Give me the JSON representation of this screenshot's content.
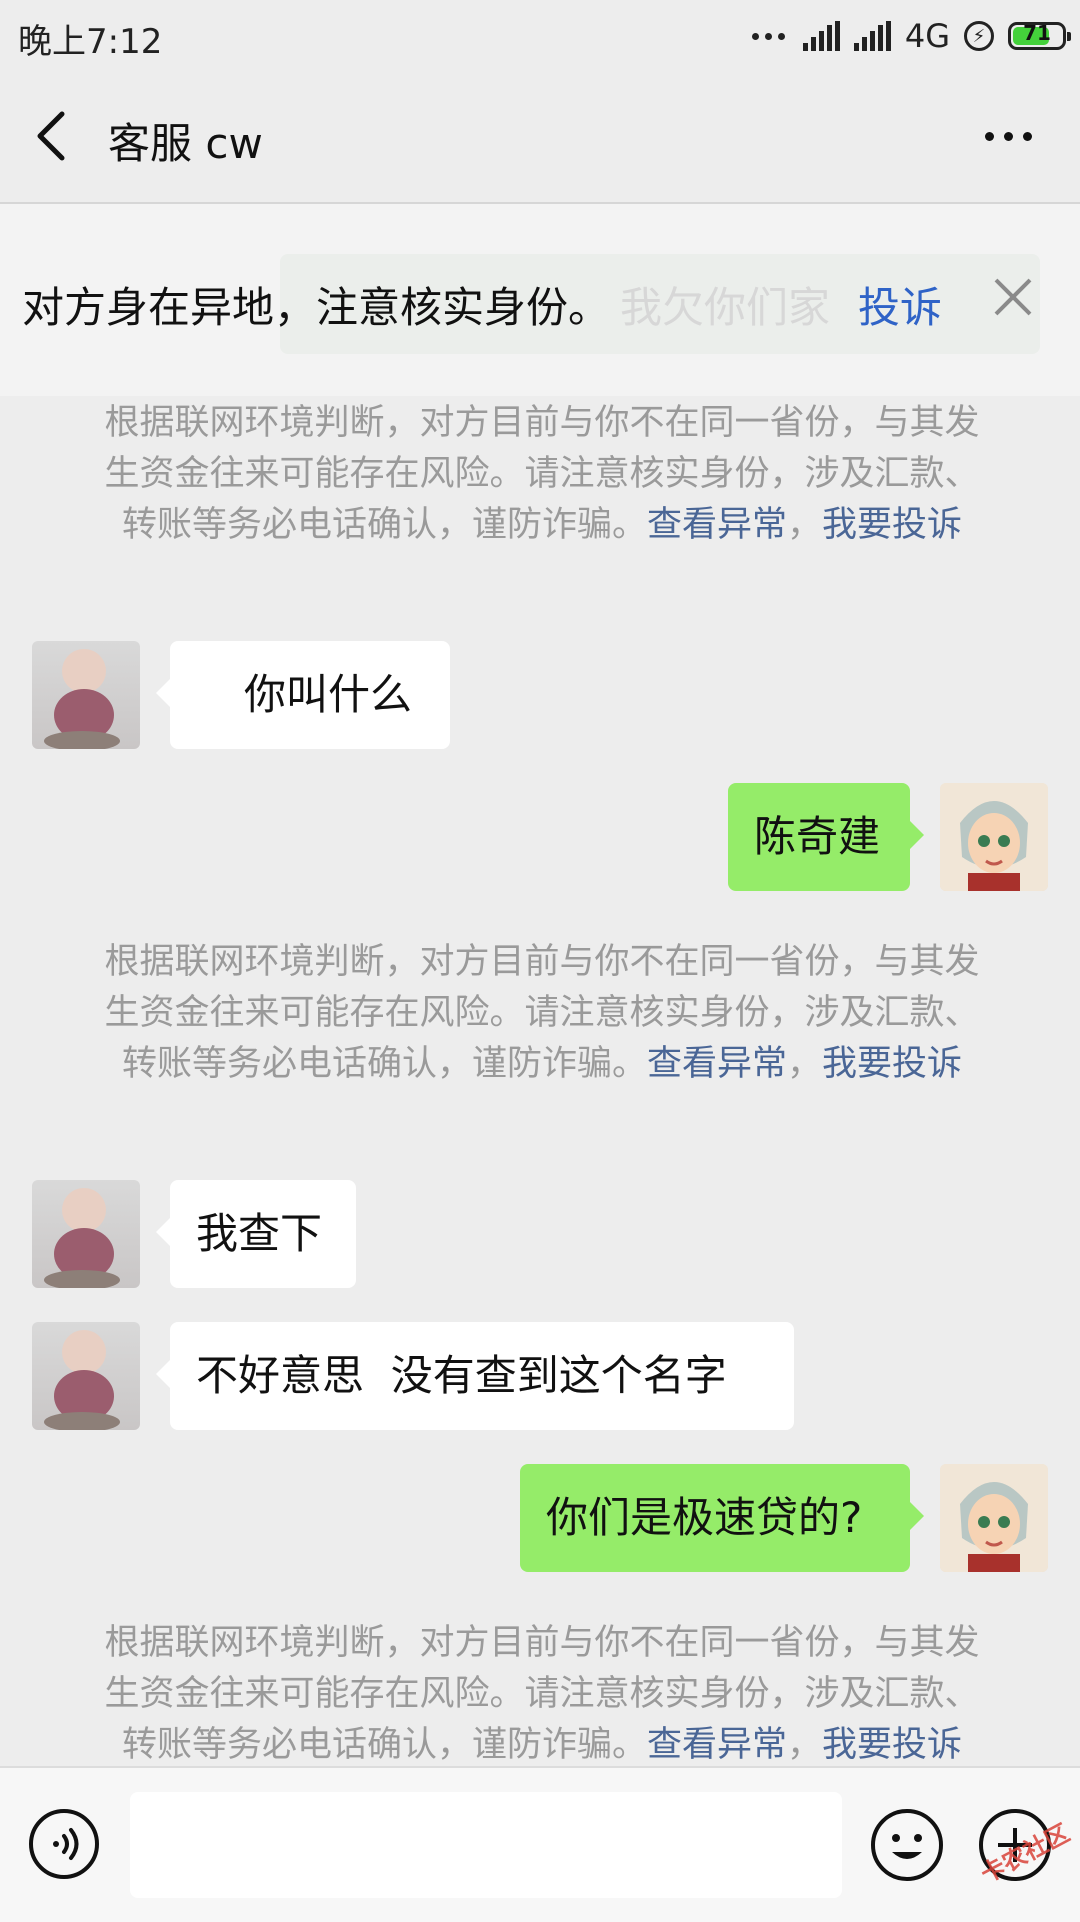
{
  "status_bar": {
    "time": "晚上7:12",
    "network": "4G",
    "battery_level": "71"
  },
  "header": {
    "title": "客服 cw"
  },
  "banner": {
    "text": "对方身在异地，注意核实身份。",
    "link": "投诉",
    "ghost_text": "我欠你们家"
  },
  "notice": {
    "text": "根据联网环境判断，对方目前与你不在同一省份，与其发生资金往来可能存在风险。请注意核实身份，涉及汇款、转账等务必电话确认，谨防诈骗。",
    "link_view": "查看异常",
    "separator": "，",
    "link_report": "我要投诉"
  },
  "messages": [
    {
      "side": "in",
      "text": "你叫什么"
    },
    {
      "side": "out",
      "text": "陈奇建"
    },
    {
      "side": "in",
      "text": "我查下"
    },
    {
      "side": "in",
      "text": "不好意思  没有查到这个名字"
    },
    {
      "side": "out",
      "text": "你们是极速贷的?"
    }
  ],
  "watermark": "卡农社区",
  "colors": {
    "outgoing_bubble": "#95ec69",
    "link": "#4a6696",
    "banner_link": "#2f63c7"
  },
  "icons": [
    "back-arrow-icon",
    "more-icon",
    "close-icon",
    "voice-icon",
    "emoji-icon",
    "plus-icon"
  ]
}
